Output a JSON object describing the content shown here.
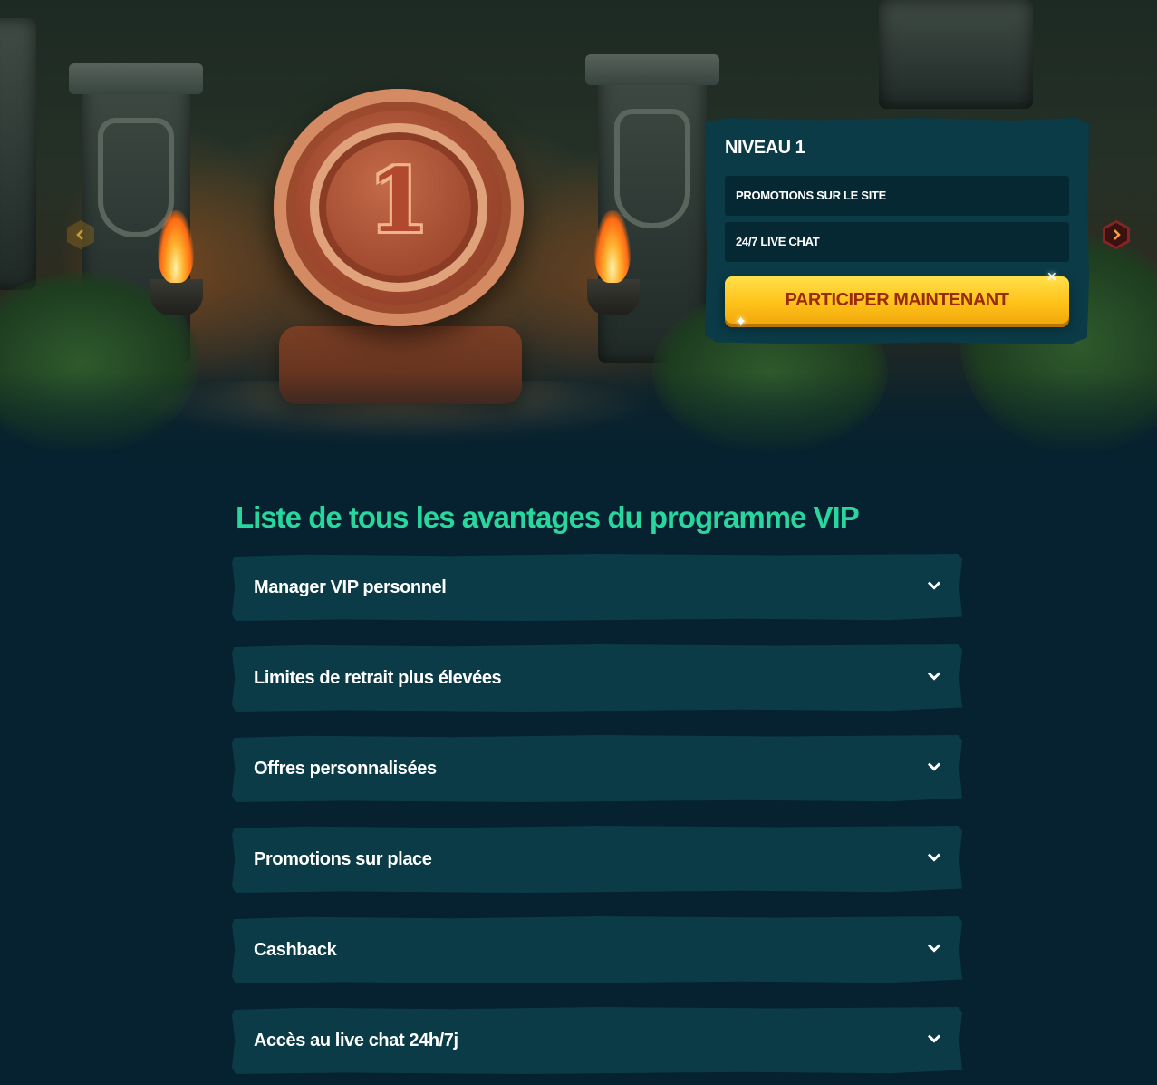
{
  "hero": {
    "coin_numeral": "1",
    "prev_icon": "chevron-left-icon",
    "next_icon": "chevron-right-icon"
  },
  "level_card": {
    "title": "NIVEAU 1",
    "perks": [
      "PROMOTIONS SUR LE SITE",
      "24/7 LIVE CHAT"
    ],
    "cta_label": "PARTICIPER MAINTENANT",
    "colors": {
      "card_bg": "#0a3b47",
      "perk_bg": "#062833",
      "cta_bg": "#ffc31a",
      "cta_text": "#9a2a08"
    }
  },
  "benefits": {
    "title": "Liste de tous les avantages du programme VIP",
    "title_color": "#29d79e",
    "items": [
      {
        "label": "Manager VIP personnel",
        "icon": "chevron-down-icon"
      },
      {
        "label": "Limites de retrait plus élevées",
        "icon": "chevron-down-icon"
      },
      {
        "label": "Offres personnalisées",
        "icon": "chevron-down-icon"
      },
      {
        "label": "Promotions sur place",
        "icon": "chevron-down-icon"
      },
      {
        "label": "Cashback",
        "icon": "chevron-down-icon"
      },
      {
        "label": "Accès au live chat 24h/7j",
        "icon": "chevron-down-icon"
      }
    ]
  }
}
